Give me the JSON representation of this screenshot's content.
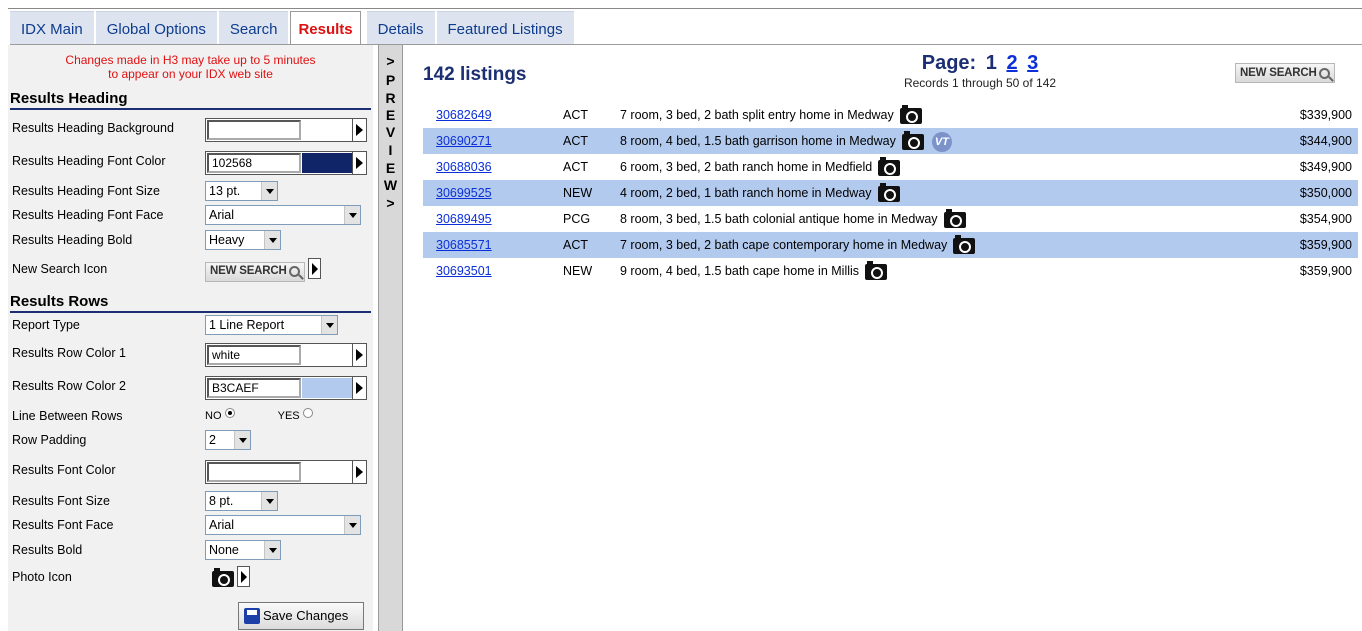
{
  "tabs": [
    {
      "label": "IDX Main"
    },
    {
      "label": "Global Options"
    },
    {
      "label": "Search"
    },
    {
      "label": "Results",
      "active": true
    },
    {
      "label": "Details"
    },
    {
      "label": "Featured Listings"
    }
  ],
  "notice": {
    "line1": "Changes made in H3 may take up to 5 minutes",
    "line2": "to appear on your IDX web site"
  },
  "heading_section": {
    "title": "Results Heading",
    "background": {
      "label": "Results Heading Background",
      "value": "",
      "swatch": "#ffffff"
    },
    "font_color": {
      "label": "Results Heading Font Color",
      "value": "102568",
      "swatch": "#102568"
    },
    "font_size": {
      "label": "Results Heading Font Size",
      "value": "13 pt."
    },
    "font_face": {
      "label": "Results Heading Font Face",
      "value": "Arial"
    },
    "bold": {
      "label": "Results Heading Bold",
      "value": "Heavy"
    },
    "new_search_icon": {
      "label": "New Search Icon",
      "button": "NEW SEARCH"
    }
  },
  "rows_section": {
    "title": "Results Rows",
    "report_type": {
      "label": "Report Type",
      "value": "1 Line Report"
    },
    "row_color_1": {
      "label": "Results Row Color 1",
      "value": "white",
      "swatch": "#ffffff"
    },
    "row_color_2": {
      "label": "Results Row Color 2",
      "value": "B3CAEF",
      "swatch": "#b3caef"
    },
    "line_between": {
      "label": "Line Between Rows",
      "no": "NO",
      "yes": "YES",
      "selected": "NO"
    },
    "row_padding": {
      "label": "Row Padding",
      "value": "2"
    },
    "font_color": {
      "label": "Results Font Color",
      "value": "",
      "swatch": "#ffffff"
    },
    "font_size": {
      "label": "Results Font Size",
      "value": "8 pt."
    },
    "font_face": {
      "label": "Results Font Face",
      "value": "Arial"
    },
    "bold": {
      "label": "Results Bold",
      "value": "None"
    },
    "photo_icon": {
      "label": "Photo Icon",
      "icon": "camera-icon"
    }
  },
  "save_button": "Save Changes",
  "preview": {
    "chars": [
      ">",
      "P",
      "R",
      "E",
      "V",
      "I",
      "E",
      "W",
      ">"
    ]
  },
  "results": {
    "count": "142 listings",
    "page_label": "Page:",
    "pages": [
      "1",
      "2",
      "3"
    ],
    "current_page": "1",
    "records": "Records 1 through 50 of 142",
    "new_search": "NEW SEARCH",
    "row_colors": {
      "row1": "#ffffff",
      "row2": "#b3caef"
    },
    "listings": [
      {
        "mls": "30682649",
        "status": "ACT",
        "desc": "7 room, 3 bed, 2 bath split entry home in Medway",
        "price": "$339,900",
        "vt": false
      },
      {
        "mls": "30690271",
        "status": "ACT",
        "desc": "8 room, 4 bed, 1.5 bath garrison home in Medway",
        "price": "$344,900",
        "vt": true
      },
      {
        "mls": "30688036",
        "status": "ACT",
        "desc": "6 room, 3 bed, 2 bath ranch home in Medfield",
        "price": "$349,900",
        "vt": false
      },
      {
        "mls": "30699525",
        "status": "NEW",
        "desc": "4 room, 2 bed, 1 bath ranch home in Medway",
        "price": "$350,000",
        "vt": false
      },
      {
        "mls": "30689495",
        "status": "PCG",
        "desc": "8 room, 3 bed, 1.5 bath colonial antique home in Medway",
        "price": "$354,900",
        "vt": false
      },
      {
        "mls": "30685571",
        "status": "ACT",
        "desc": "7 room, 3 bed, 2 bath cape contemporary home in Medway",
        "price": "$359,900",
        "vt": false
      },
      {
        "mls": "30693501",
        "status": "NEW",
        "desc": "9 room, 4 bed, 1.5 bath cape home in Millis",
        "price": "$359,900",
        "vt": false
      }
    ]
  }
}
